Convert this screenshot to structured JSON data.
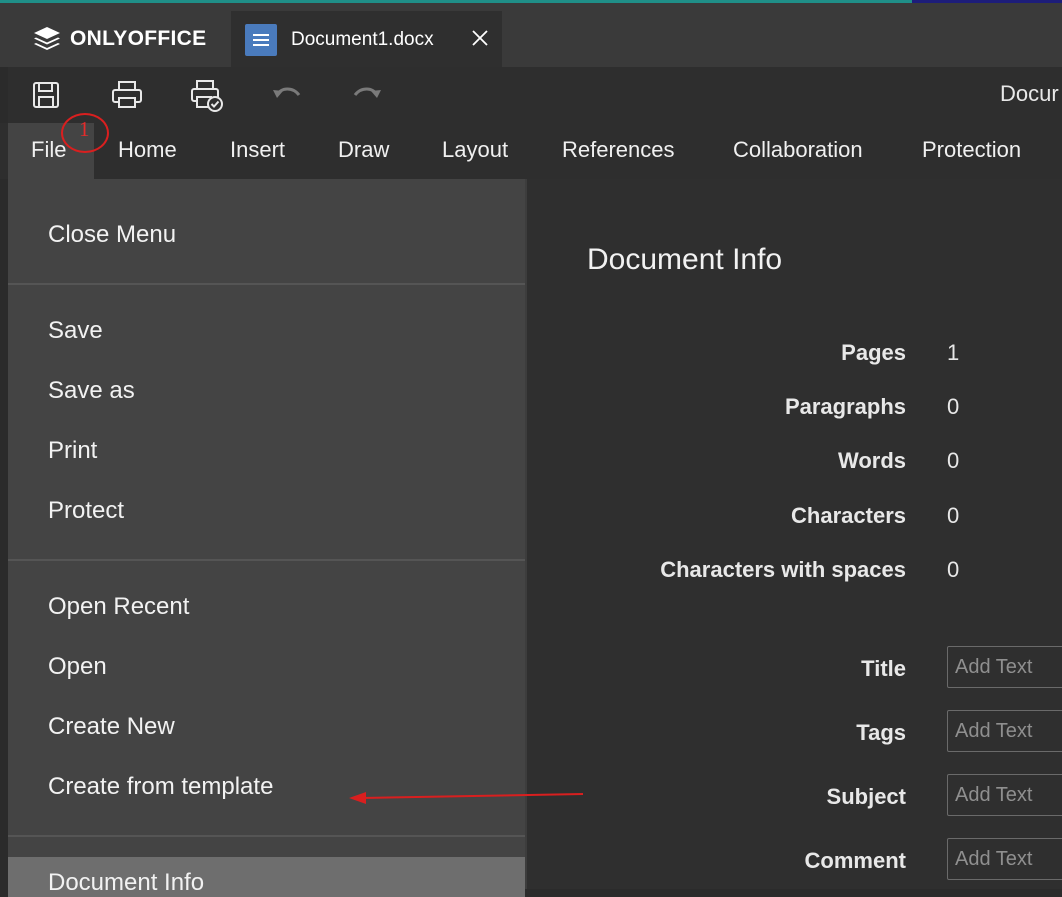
{
  "app": {
    "logo_text": "ONLYOFFICE"
  },
  "tab": {
    "title": "Document1.docx"
  },
  "toolbar": {
    "doc_name_partial": "Docur"
  },
  "menubar": {
    "items": [
      "File",
      "Home",
      "Insert",
      "Draw",
      "Layout",
      "References",
      "Collaboration",
      "Protection"
    ]
  },
  "annotation": {
    "number": "1"
  },
  "file_menu": {
    "close": "Close Menu",
    "save": "Save",
    "save_as": "Save as",
    "print": "Print",
    "protect": "Protect",
    "open_recent": "Open Recent",
    "open": "Open",
    "create_new": "Create New",
    "create_from_template": "Create from template",
    "document_info": "Document Info"
  },
  "doc_info": {
    "title": "Document Info",
    "stats": [
      {
        "label": "Pages",
        "value": "1"
      },
      {
        "label": "Paragraphs",
        "value": "0"
      },
      {
        "label": "Words",
        "value": "0"
      },
      {
        "label": "Characters",
        "value": "0"
      },
      {
        "label": "Characters with spaces",
        "value": "0"
      }
    ],
    "fields": [
      {
        "label": "Title",
        "placeholder": "Add Text"
      },
      {
        "label": "Tags",
        "placeholder": "Add Text"
      },
      {
        "label": "Subject",
        "placeholder": "Add Text"
      },
      {
        "label": "Comment",
        "placeholder": "Add Text"
      }
    ]
  },
  "colors": {
    "annotation_red": "#d91f1f",
    "doc_icon_blue": "#4a7bbd"
  },
  "icons": [
    "logo-icon",
    "document-icon",
    "close-icon",
    "save-icon",
    "print-icon",
    "quick-print-icon",
    "undo-icon",
    "redo-icon"
  ]
}
